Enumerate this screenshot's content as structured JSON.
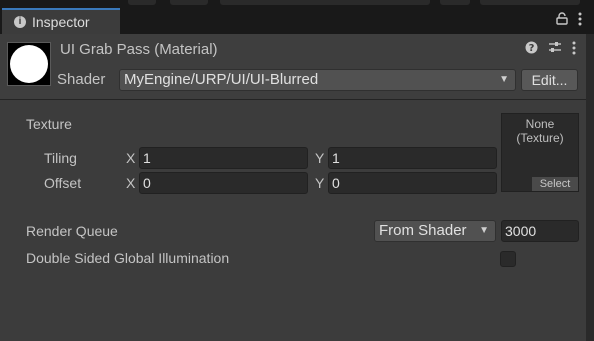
{
  "tab": {
    "title": "Inspector"
  },
  "material": {
    "title": "UI Grab Pass (Material)",
    "shader_label": "Shader",
    "shader_value": "MyEngine/URP/UI/UI-Blurred",
    "edit_label": "Edit..."
  },
  "properties": {
    "texture_label": "Texture",
    "tiling_label": "Tiling",
    "offset_label": "Offset",
    "x_label": "X",
    "y_label": "Y",
    "tiling_x": "1",
    "tiling_y": "1",
    "offset_x": "0",
    "offset_y": "0",
    "texture_slot_text": "None\n(Texture)",
    "texture_select_label": "Select",
    "render_queue_label": "Render Queue",
    "render_queue_mode": "From Shader",
    "render_queue_value": "3000",
    "double_sided_gi_label": "Double Sided Global Illumination"
  },
  "icons": {
    "tab": "info-icon",
    "lock": "lock-icon",
    "more": "more-icon",
    "help": "help-icon",
    "preset": "preset-icon"
  },
  "colors": {
    "background": "#3c3c3c",
    "field": "#2a2a2a",
    "accent": "#3a79bb"
  }
}
